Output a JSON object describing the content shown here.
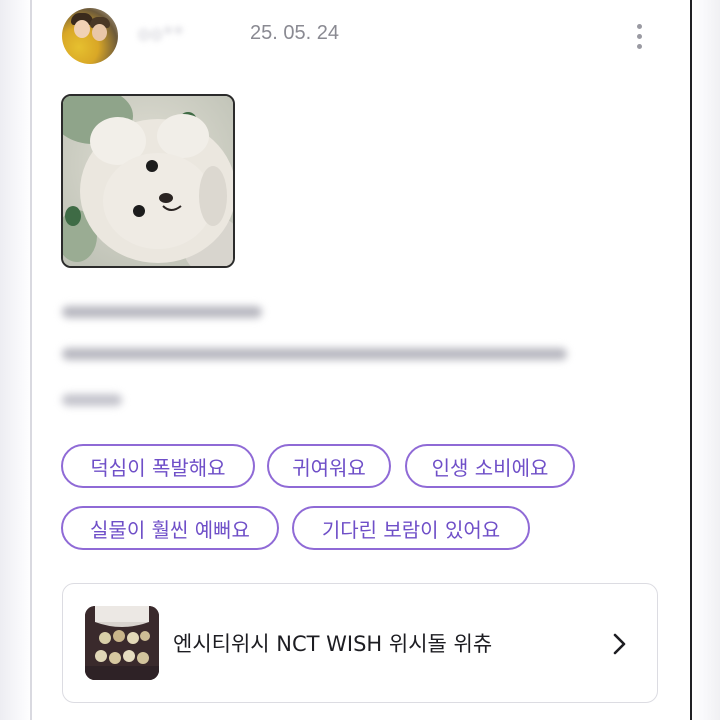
{
  "post": {
    "author_name": "oo**",
    "date": "25. 05. 24"
  },
  "tags": [
    "덕심이 폭발해요",
    "귀여워요",
    "인생 소비에요",
    "실물이 훨씬 예뻐요",
    "기다린 보람이 있어요"
  ],
  "product": {
    "name": "엔시티위시 NCT WISH 위시돌 위츄"
  },
  "colors": {
    "tag_border": "#8f6ad6",
    "tag_text": "#6f4fc8",
    "date_text": "#8a8a92",
    "card_border": "#dcdce2"
  },
  "icons": {
    "menu": "kebab-vertical-icon",
    "chevron": "chevron-right-icon"
  }
}
